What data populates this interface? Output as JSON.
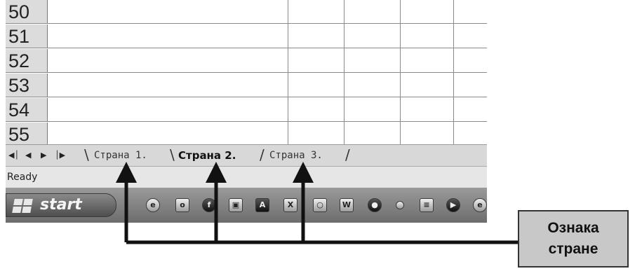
{
  "sheet": {
    "row_numbers": [
      "50",
      "51",
      "52",
      "53",
      "54",
      "55"
    ]
  },
  "tab_bar": {
    "nav_icons": [
      "first-sheet-icon",
      "prev-sheet-icon",
      "next-sheet-icon",
      "last-sheet-icon"
    ],
    "tabs": [
      {
        "label": "Страна 1.",
        "active": false
      },
      {
        "label": "Страна 2.",
        "active": true
      },
      {
        "label": "Страна 3.",
        "active": false
      }
    ]
  },
  "status_bar": {
    "text": "Ready"
  },
  "taskbar": {
    "start_label": "start",
    "quick_launch_icons": [
      "internet-explorer-icon",
      "outlook-icon",
      "firefox-icon",
      "folder-icon",
      "acrobat-icon",
      "excel-icon",
      "media-icon",
      "word-icon",
      "messenger-icon",
      "small-app-icon",
      "notepad-icon",
      "player-icon",
      "extra-icon"
    ]
  },
  "callout": {
    "text_line1": "Ознака",
    "text_line2": "стране"
  },
  "colors": {
    "arrow": "#111111",
    "callout_bg": "#c8c8c8"
  }
}
